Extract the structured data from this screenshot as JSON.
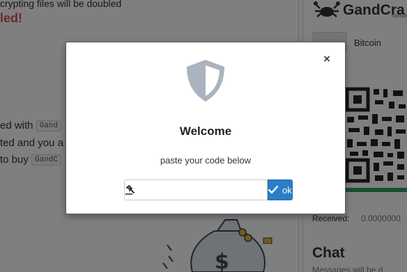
{
  "background": {
    "warning_line": "crypting files will be doubled",
    "warning_red": "led!",
    "body_lines": [
      {
        "text": "ed with",
        "code": "Gand"
      },
      {
        "text": "ted and you a",
        "code": ""
      },
      {
        "text": "to buy",
        "code": "GandC"
      }
    ],
    "brand_name": "GandCra",
    "brand_sub": "ransomw",
    "coin_label": "Bitcoin",
    "received_label": "Received:",
    "received_value": "0.0000000",
    "chat_title": "Chat",
    "chat_message": "Messages will be d"
  },
  "modal": {
    "close_label": "×",
    "title": "Welcome",
    "subtitle": "paste your code below",
    "input": {
      "value": "",
      "placeholder": ""
    },
    "ok_label": "ok",
    "icons": {
      "header": "shield-icon",
      "input_addon": "gavel-icon",
      "ok": "checkmark-icon",
      "close": "close-icon"
    }
  },
  "colors": {
    "warning_red": "#d9534f",
    "ok_button": "#2a7fc6",
    "shield": "#aab4bf",
    "progress_green": "#2e9e5c"
  }
}
